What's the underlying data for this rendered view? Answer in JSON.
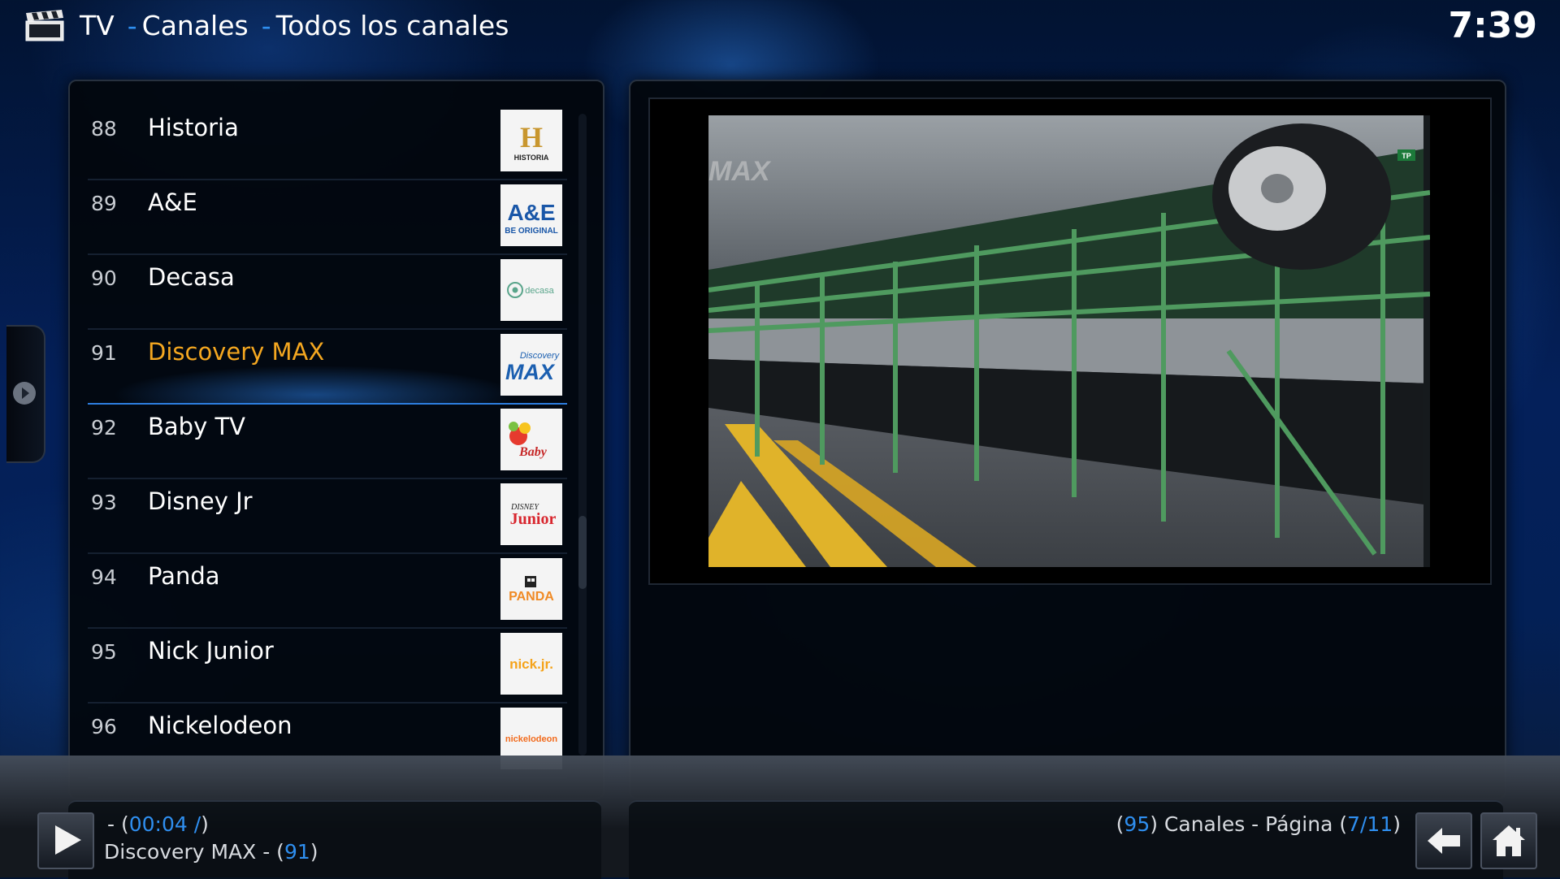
{
  "header": {
    "breadcrumb": [
      "TV",
      "Canales",
      "Todos los canales"
    ],
    "separator": "-",
    "clock": "7:39"
  },
  "channels": [
    {
      "number": "88",
      "name": "Historia",
      "logo": "historia-logo"
    },
    {
      "number": "89",
      "name": "A&E",
      "logo": "ae-logo"
    },
    {
      "number": "90",
      "name": "Decasa",
      "logo": "decasa-logo"
    },
    {
      "number": "91",
      "name": "Discovery MAX",
      "logo": "discovery-max-logo",
      "selected": true
    },
    {
      "number": "92",
      "name": "Baby TV",
      "logo": "baby-tv-logo"
    },
    {
      "number": "93",
      "name": "Disney Jr",
      "logo": "disney-junior-logo"
    },
    {
      "number": "94",
      "name": "Panda",
      "logo": "panda-logo"
    },
    {
      "number": "95",
      "name": "Nick Junior",
      "logo": "nick-jr-logo"
    },
    {
      "number": "96",
      "name": "Nickelodeon",
      "logo": "nickelodeon-logo"
    }
  ],
  "logo_text": {
    "historia_letter": "H",
    "historia": "HISTORIA",
    "ae": "A&E",
    "ae_tagline": "BE ORIGINAL",
    "decasa": "decasa",
    "discovery": "Discovery",
    "max": "MAX",
    "baby": "Baby",
    "disney": "DISNEY",
    "junior": "Junior",
    "panda": "PANDA",
    "nickjr": "nick.jr.",
    "nickelodeon": "nickelodeon"
  },
  "video": {
    "watermark": "MAX",
    "corner_badge": "TP"
  },
  "now_playing": {
    "time_prefix": "- (",
    "time": "00:04 /",
    "time_suffix": ")",
    "title_prefix": "Discovery MAX - (",
    "channel": "91",
    "title_suffix": ")"
  },
  "page_info": {
    "open": "(",
    "count": "95",
    "mid": ") Canales - Página (",
    "page": "7/11",
    "close": ")"
  }
}
